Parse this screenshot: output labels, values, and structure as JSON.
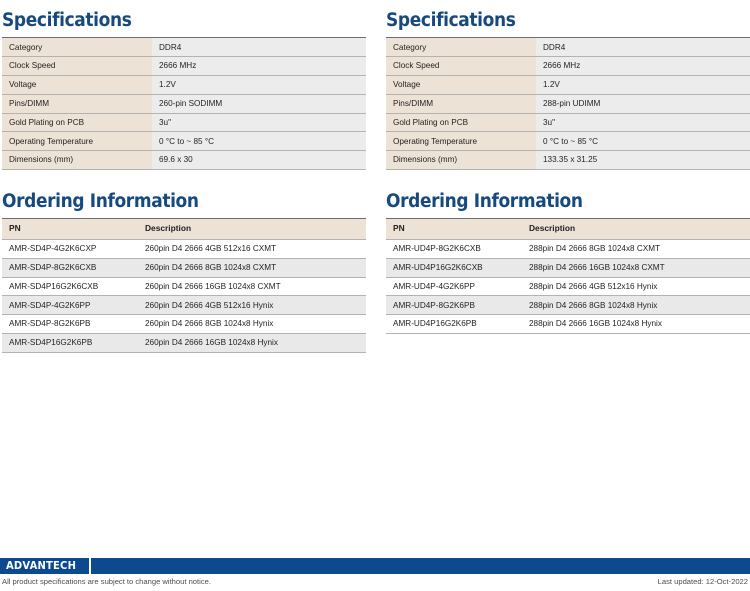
{
  "left": {
    "specifications": {
      "title": "Specifications",
      "rows": [
        {
          "label": "Category",
          "value": "DDR4"
        },
        {
          "label": "Clock Speed",
          "value": "2666 MHz"
        },
        {
          "label": "Voltage",
          "value": "1.2V"
        },
        {
          "label": "Pins/DIMM",
          "value": "260-pin SODIMM"
        },
        {
          "label": "Gold Plating on PCB",
          "value": "3u\""
        },
        {
          "label": "Operating Temperature",
          "value": "0 °C to ~ 85 °C"
        },
        {
          "label": "Dimensions (mm)",
          "value": "69.6 x 30"
        }
      ]
    },
    "ordering": {
      "title": "Ordering Information",
      "headers": {
        "pn": "PN",
        "description": "Description"
      },
      "rows": [
        {
          "pn": "AMR-SD4P-4G2K6CXP",
          "description": "260pin D4 2666 4GB  512x16 CXMT"
        },
        {
          "pn": "AMR-SD4P-8G2K6CXB",
          "description": "260pin D4 2666 8GB 1024x8 CXMT"
        },
        {
          "pn": "AMR-SD4P16G2K6CXB",
          "description": "260pin D4 2666 16GB 1024x8 CXMT"
        },
        {
          "pn": "AMR-SD4P-4G2K6PP",
          "description": "260pin D4 2666 4GB 512x16 Hynix"
        },
        {
          "pn": "AMR-SD4P-8G2K6PB",
          "description": "260pin D4 2666 8GB 1024x8 Hynix"
        },
        {
          "pn": "AMR-SD4P16G2K6PB",
          "description": "260pin D4 2666 16GB 1024x8 Hynix"
        }
      ]
    }
  },
  "right": {
    "specifications": {
      "title": "Specifications",
      "rows": [
        {
          "label": "Category",
          "value": "DDR4"
        },
        {
          "label": "Clock Speed",
          "value": "2666 MHz"
        },
        {
          "label": "Voltage",
          "value": "1.2V"
        },
        {
          "label": "Pins/DIMM",
          "value": "288-pin UDIMM"
        },
        {
          "label": "Gold Plating on PCB",
          "value": "3u\""
        },
        {
          "label": "Operating Temperature",
          "value": "0 °C to ~ 85 °C"
        },
        {
          "label": "Dimensions (mm)",
          "value": "133.35 x 31.25"
        }
      ]
    },
    "ordering": {
      "title": "Ordering Information",
      "headers": {
        "pn": "PN",
        "description": "Description"
      },
      "rows": [
        {
          "pn": "AMR-UD4P-8G2K6CXB",
          "description": "288pin D4 2666 8GB 1024x8 CXMT"
        },
        {
          "pn": "AMR-UD4P16G2K6CXB",
          "description": "288pin D4 2666 16GB 1024x8 CXMT"
        },
        {
          "pn": "AMR-UD4P-4G2K6PP",
          "description": "288pin D4 2666 4GB 512x16 Hynix"
        },
        {
          "pn": "AMR-UD4P-8G2K6PB",
          "description": "288pin D4 2666 8GB 1024x8 Hynix"
        },
        {
          "pn": "AMR-UD4P16G2K6PB",
          "description": "288pin D4 2666 16GB 1024x8 Hynix"
        }
      ]
    }
  },
  "footer": {
    "logo_text": "ADVANTECH",
    "disclaimer": "All product specifications are subject to change without notice.",
    "last_updated": "Last updated: 12-Oct-2022"
  },
  "colors": {
    "heading_blue": "#164a7f",
    "footer_bar_blue": "#0b4a8f",
    "spec_label_bg": "#ece2d6",
    "spec_value_bg": "#ececec",
    "order_alt_row_bg": "#e9e9e9",
    "rule": "#6e6e6e"
  }
}
